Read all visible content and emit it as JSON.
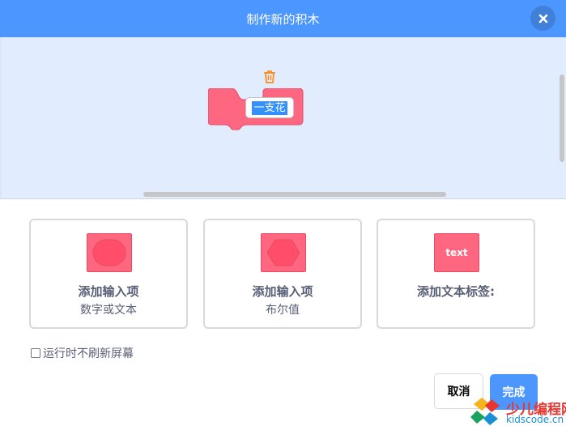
{
  "header": {
    "title": "制作新的积木"
  },
  "block": {
    "input_value": "一支花"
  },
  "options": [
    {
      "title": "添加输入项",
      "subtitle": "数字或文本"
    },
    {
      "title": "添加输入项",
      "subtitle": "布尔值"
    },
    {
      "title": "添加文本标签:",
      "subtitle": "",
      "icon_text": "text"
    }
  ],
  "checkbox": {
    "label": "运行时不刷新屏幕"
  },
  "buttons": {
    "cancel_label": "取消",
    "ok_label": "完成"
  },
  "watermark": {
    "title": "少儿编程网",
    "subtitle": "kidscode.cn"
  },
  "colors": {
    "header": "#4c97ff",
    "workspace": "#e1ecff",
    "block": "#ff6680",
    "trash": "#ff8c1a"
  }
}
